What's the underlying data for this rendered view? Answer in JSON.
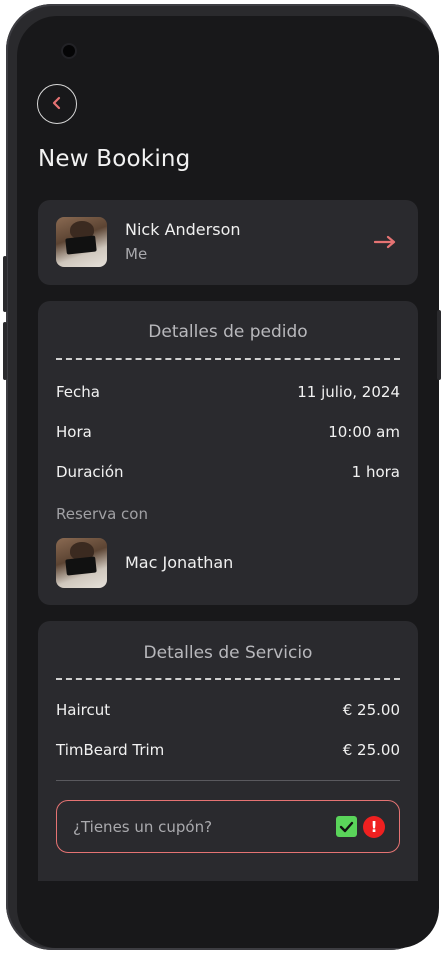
{
  "header": {
    "title": "New Booking"
  },
  "client": {
    "name": "Nick Anderson",
    "relation": "Me"
  },
  "order_details": {
    "title": "Detalles de pedido",
    "rows": [
      {
        "label": "Fecha",
        "value": "11 julio, 2024"
      },
      {
        "label": "Hora",
        "value": "10:00 am"
      },
      {
        "label": "Duración",
        "value": "1 hora"
      }
    ],
    "booked_with_label": "Reserva con",
    "staff_name": "Mac Jonathan"
  },
  "service_details": {
    "title": "Detalles de Servicio",
    "items": [
      {
        "name": "Haircut",
        "price": "€ 25.00"
      },
      {
        "name": "TimBeard Trim",
        "price": "€ 25.00"
      }
    ]
  },
  "coupon": {
    "placeholder": "¿Tienes un cupón?",
    "accent_color": "#e57373"
  },
  "colors": {
    "background": "#18181a",
    "card": "#2a2a2e",
    "accent": "#e57373"
  },
  "icons": {
    "back": "chevron-left-icon",
    "forward": "arrow-right-icon",
    "check": "check-icon",
    "alert": "alert-icon"
  }
}
